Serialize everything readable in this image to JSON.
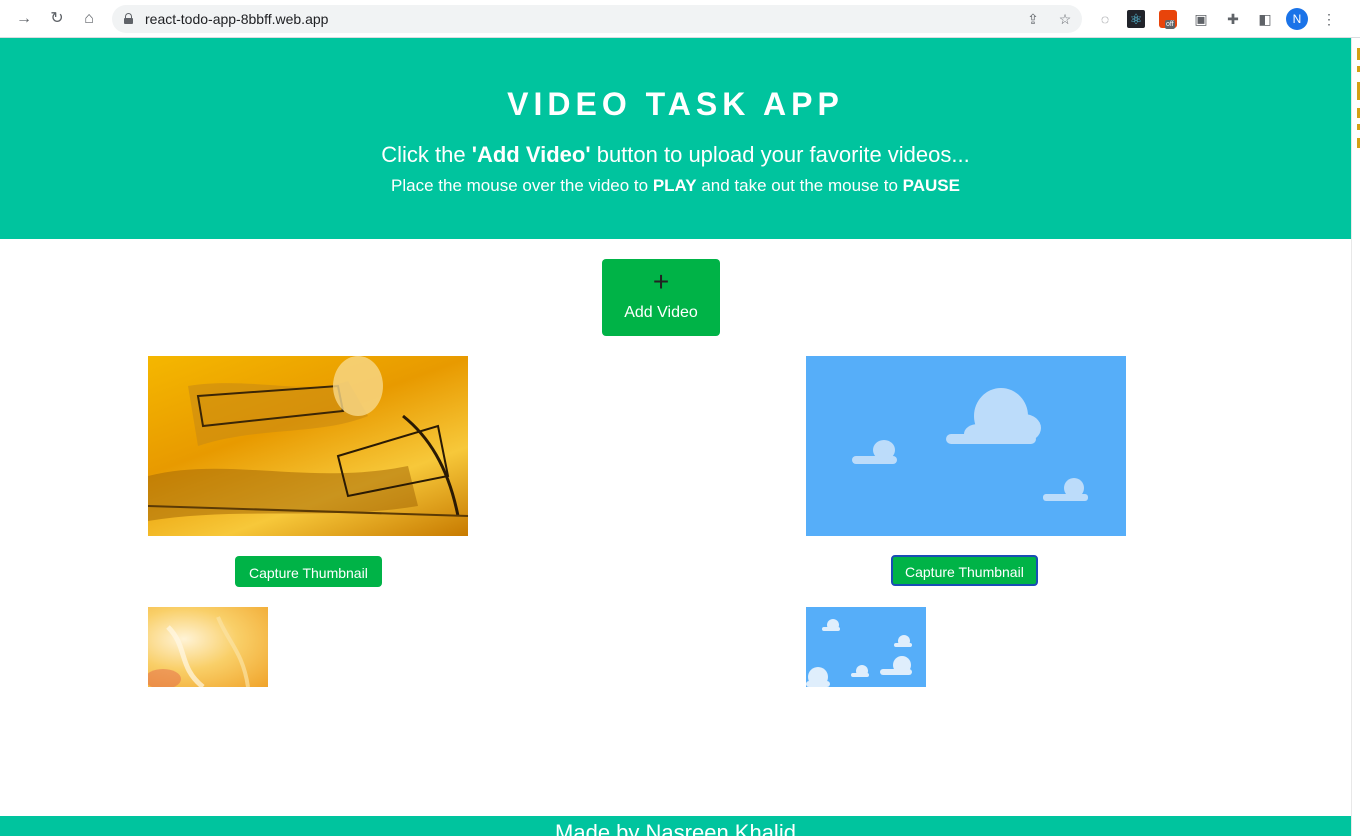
{
  "browser": {
    "url": "react-todo-app-8bbff.web.app",
    "profile_initial": "N",
    "extension_badge": "off"
  },
  "hero": {
    "title": "VIDEO TASK APP",
    "line1_pre": "Click the ",
    "line1_bold": "'Add Video'",
    "line1_post": " button to upload your favorite videos...",
    "line2_pre": "Place the mouse over the video to ",
    "line2_bold1": "PLAY",
    "line2_mid": " and take out the mouse to ",
    "line2_bold2": "PAUSE"
  },
  "add_button": {
    "icon": "+",
    "label": "Add Video"
  },
  "videos": [
    {
      "capture_label": "Capture Thumbnail"
    },
    {
      "capture_label": "Capture Thumbnail"
    }
  ],
  "footer": {
    "text": "Made by Nasreen Khalid"
  },
  "colors": {
    "header_bg": "#00c49e",
    "button_green": "#00b347",
    "sky_blue": "#56aef9"
  }
}
